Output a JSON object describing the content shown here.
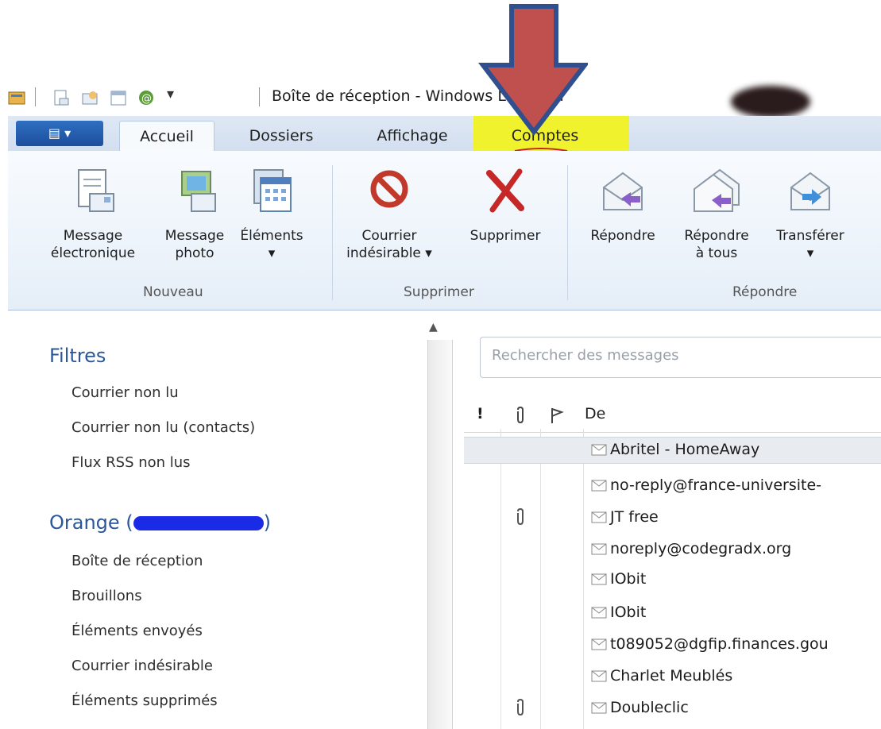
{
  "window": {
    "title": "Boîte de réception - Windows Live Mail"
  },
  "ribbon_tabs": [
    "Accueil",
    "Dossiers",
    "Affichage",
    "Comptes"
  ],
  "ribbon": {
    "groups": {
      "nouveau": {
        "label": "Nouveau",
        "buttons": [
          {
            "line1": "Message",
            "line2": "électronique",
            "icon": "new-email-icon"
          },
          {
            "line1": "Message",
            "line2": "photo",
            "icon": "photo-email-icon"
          },
          {
            "line1": "Éléments",
            "line2": "▾",
            "icon": "items-calendar-icon"
          }
        ]
      },
      "supprimer": {
        "label": "Supprimer",
        "buttons": [
          {
            "line1": "Courrier",
            "line2": "indésirable ▾",
            "icon": "junk-icon"
          },
          {
            "line1": "Supprimer",
            "line2": "",
            "icon": "delete-icon"
          }
        ]
      },
      "repondre": {
        "label": "Répondre",
        "buttons": [
          {
            "line1": "Répondre",
            "line2": "",
            "icon": "reply-icon"
          },
          {
            "line1": "Répondre",
            "line2": "à tous",
            "icon": "reply-all-icon"
          },
          {
            "line1": "Transférer",
            "line2": "▾",
            "icon": "forward-icon"
          }
        ]
      }
    }
  },
  "left_pane": {
    "filters_title": "Filtres",
    "filters": [
      "Courrier non lu",
      "Courrier non lu (contacts)",
      "Flux RSS non lus"
    ],
    "account_title": "Orange (",
    "account_suffix": ")",
    "folders": [
      "Boîte de réception",
      "Brouillons",
      "Éléments envoyés",
      "Courrier indésirable",
      "Éléments supprimés"
    ]
  },
  "search": {
    "placeholder": "Rechercher des messages"
  },
  "message_list": {
    "headers": {
      "importance": "!",
      "attachment": "icon",
      "flag": "icon",
      "from": "De"
    },
    "rows": [
      {
        "from": "Abritel - HomeAway",
        "attachment": false,
        "selected": true
      },
      {
        "from": "no-reply@france-universite-",
        "attachment": false,
        "selected": false
      },
      {
        "from": "JT free",
        "attachment": true,
        "selected": false
      },
      {
        "from": "noreply@codegradx.org",
        "attachment": false,
        "selected": false
      },
      {
        "from": "IObit",
        "attachment": false,
        "selected": false
      },
      {
        "from": "IObit",
        "attachment": false,
        "selected": false
      },
      {
        "from": "t089052@dgfip.finances.gou",
        "attachment": false,
        "selected": false
      },
      {
        "from": "Charlet Meublés",
        "attachment": false,
        "selected": false
      },
      {
        "from": "Doubleclic",
        "attachment": true,
        "selected": false
      }
    ]
  },
  "colors": {
    "arrow": "#c0504d",
    "arrow_outline": "#2f4f8f",
    "highlight": "#f0f22e",
    "accent": "#2b579a"
  }
}
